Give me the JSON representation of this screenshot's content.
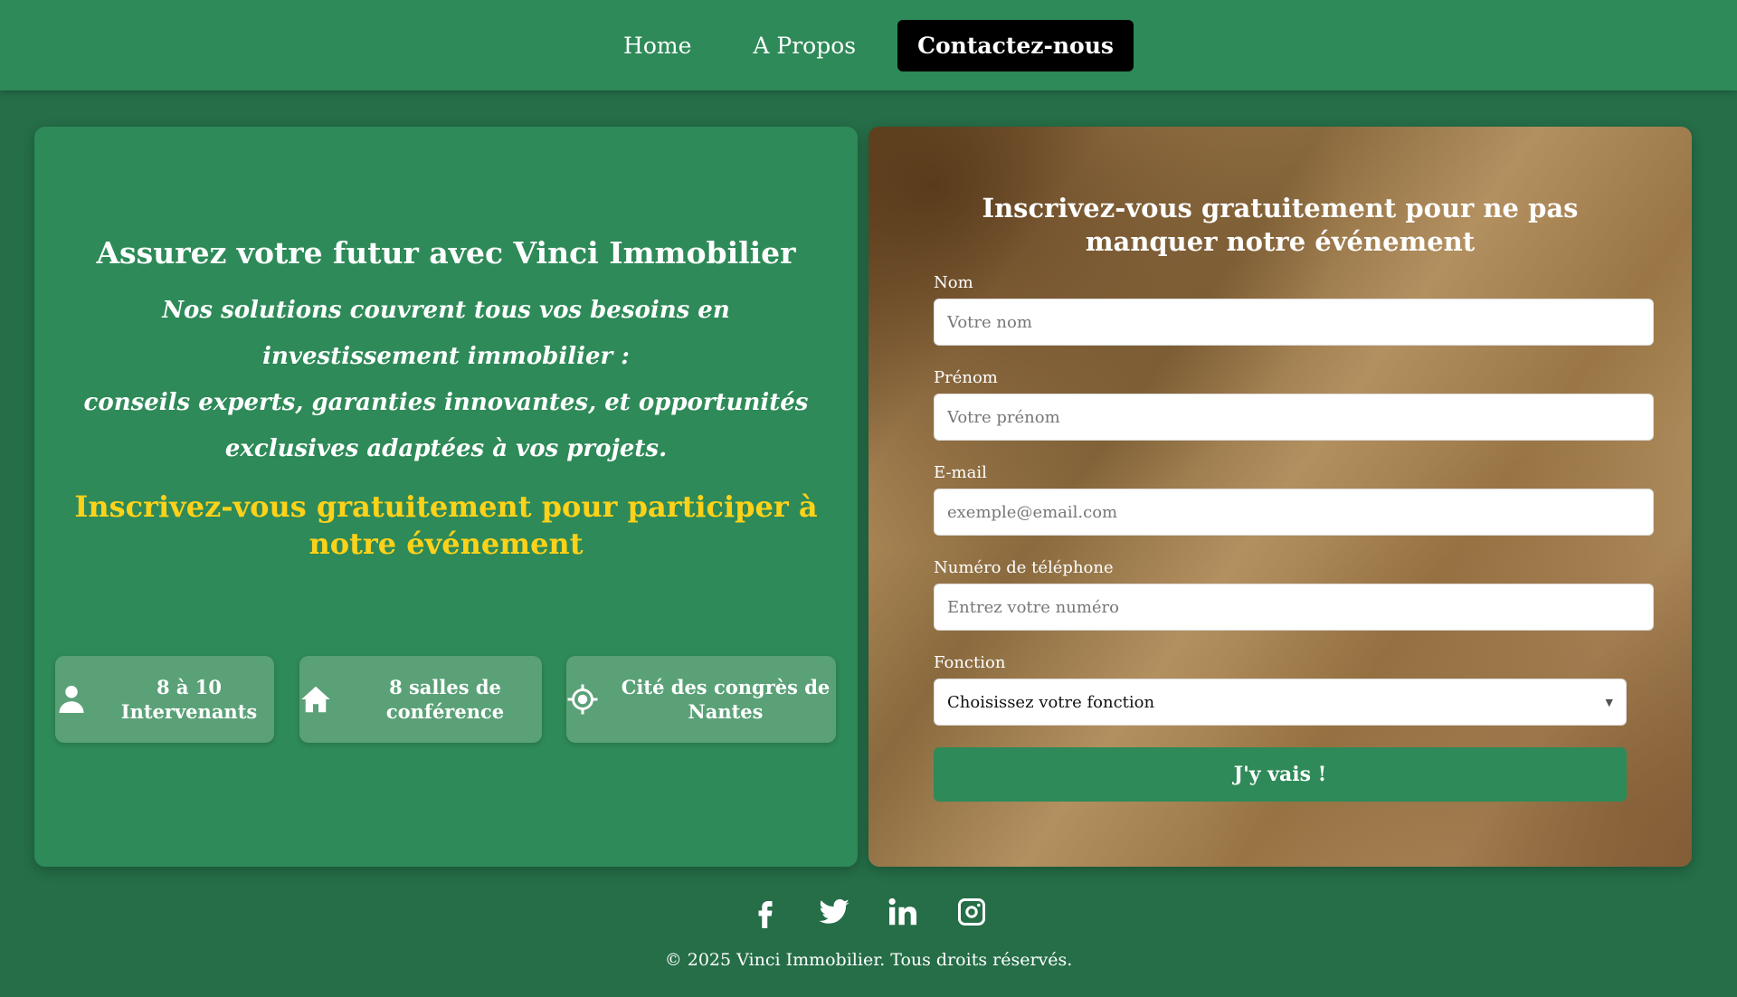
{
  "nav": {
    "items": [
      {
        "label": "Home"
      },
      {
        "label": "A Propos"
      },
      {
        "label": "Contactez-nous"
      }
    ]
  },
  "hero": {
    "title": "Assurez votre futur avec Vinci Immobilier",
    "description_line1": "Nos solutions couvrent tous vos besoins en investissement immobilier :",
    "description_line2": "conseils experts, garanties innovantes, et opportunités exclusives adaptées à vos projets.",
    "cta": "Inscrivez-vous gratuitement pour participer à notre événement"
  },
  "features": [
    {
      "icon": "person-icon",
      "text": "8 à 10 Intervenants"
    },
    {
      "icon": "house-icon",
      "text": "8 salles de conférence"
    },
    {
      "icon": "location-target-icon",
      "text": "Cité des congrès de Nantes"
    }
  ],
  "form": {
    "title": "Inscrivez-vous gratuitement pour ne pas manquer notre événement",
    "fields": {
      "nom": {
        "label": "Nom",
        "placeholder": "Votre nom"
      },
      "prenom": {
        "label": "Prénom",
        "placeholder": "Votre prénom"
      },
      "email": {
        "label": "E-mail",
        "placeholder": "exemple@email.com"
      },
      "telephone": {
        "label": "Numéro de téléphone",
        "placeholder": "Entrez votre numéro"
      }
    },
    "fonction": {
      "label": "Fonction",
      "selected": "Choisissez votre fonction"
    },
    "submit_label": "J'y vais !"
  },
  "footer": {
    "social": [
      "facebook-icon",
      "twitter-icon",
      "linkedin-icon",
      "instagram-icon"
    ],
    "copyright": "© 2025 Vinci Immobilier. Tous droits réservés."
  },
  "colors": {
    "page_bg": "#256e48",
    "card_green": "#2e8a58",
    "feature_bg": "#5aa177",
    "cta_yellow": "#ffd21a",
    "active_nav_bg": "#000000"
  }
}
